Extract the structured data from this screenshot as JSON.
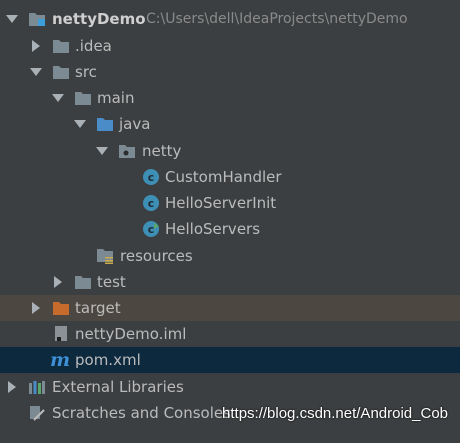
{
  "project": {
    "name": "nettyDemo",
    "path": "C:\\Users\\dell\\IdeaProjects\\nettyDemo"
  },
  "tree": {
    "idea": ".idea",
    "src": "src",
    "main": "main",
    "java": "java",
    "netty": "netty",
    "classes": [
      "CustomHandler",
      "HelloServerInit",
      "HelloServers"
    ],
    "resources": "resources",
    "test": "test",
    "target": "target",
    "iml": "nettyDemo.iml",
    "pom": "pom.xml",
    "external_libraries": "External Libraries",
    "scratches": "Scratches and Consoles"
  },
  "colors": {
    "background": "#3c3f41",
    "folder": "#7c8a94",
    "source_folder": "#4a8cc7",
    "excluded_folder": "#c66b2c",
    "class_icon": "#3e8fb6",
    "selected_row": "#0d293e",
    "highlight_row": "#4c4740"
  },
  "icons": {
    "expanded": "triangle-down",
    "collapsed": "triangle-right",
    "module": "module-folder-icon",
    "package": "package-icon",
    "class": "class-c-icon"
  },
  "watermark": "https://blog.csdn.net/Android_Cob"
}
